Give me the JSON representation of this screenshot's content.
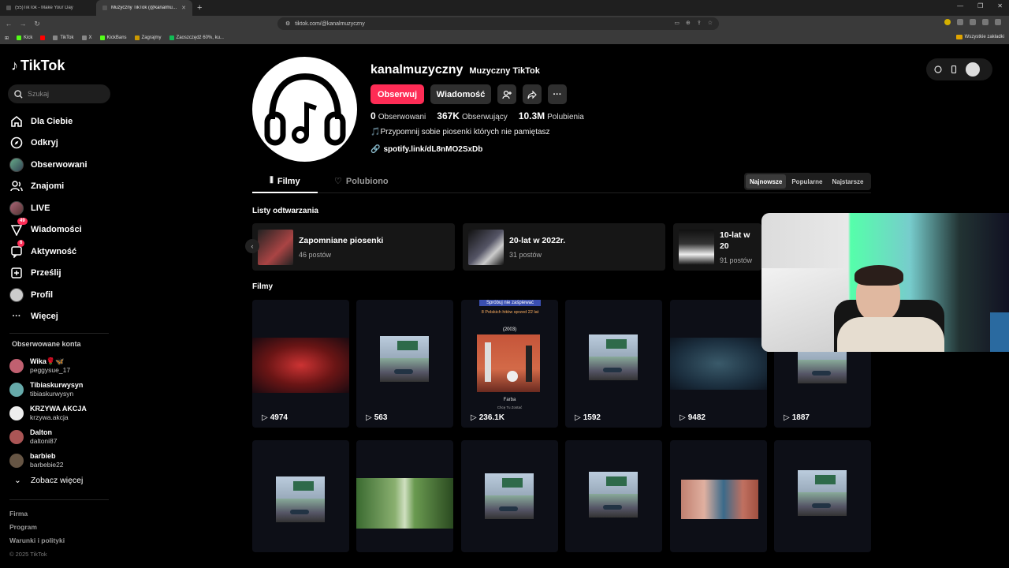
{
  "browser": {
    "tabs": [
      {
        "title": "(55)TikTok - Make Your Day",
        "active": false
      },
      {
        "title": "Muzyczny TikTok (@kanalmuzyczny)",
        "active": true
      }
    ],
    "url": "tiktok.com/@kanalmuzyczny",
    "bookmarks": [
      "Kick",
      "",
      "TikTok",
      "X",
      "KickBans",
      "Zagrajmy",
      "Zaoszczędź 60%, ku..."
    ],
    "all_bookmarks": "Wszystkie zakładki"
  },
  "sidebar": {
    "logo": "TikTok",
    "search_placeholder": "Szukaj",
    "nav": [
      {
        "label": "Dla Ciebie",
        "icon": "home-icon"
      },
      {
        "label": "Odkryj",
        "icon": "compass-icon"
      },
      {
        "label": "Obserwowani",
        "icon": "avatar"
      },
      {
        "label": "Znajomi",
        "icon": "friends-icon"
      },
      {
        "label": "LIVE",
        "icon": "avatar"
      },
      {
        "label": "Wiadomości",
        "icon": "messages-icon",
        "badge": "49"
      },
      {
        "label": "Aktywność",
        "icon": "activity-icon",
        "badge": "6"
      },
      {
        "label": "Prześlij",
        "icon": "upload-icon"
      },
      {
        "label": "Profil",
        "icon": "avatar"
      },
      {
        "label": "Więcej",
        "icon": "more-icon"
      }
    ],
    "followed_title": "Obserwowane konta",
    "followed": [
      {
        "name": "Wika🌹🦋",
        "handle": "peggysue_17",
        "color": "#c06070"
      },
      {
        "name": "Tibiaskurwysyn",
        "handle": "tibiaskurwysyn",
        "color": "#6aa"
      },
      {
        "name": "KRZYWA AKCJA",
        "handle": "krzywa.akcja",
        "color": "#eee"
      },
      {
        "name": "Dalton",
        "handle": "daltoni87",
        "color": "#a55"
      },
      {
        "name": "barbieb",
        "handle": "barbebie22",
        "color": "#654"
      }
    ],
    "see_more": "Zobacz więcej",
    "footer": [
      "Firma",
      "Program",
      "Warunki i polityki"
    ],
    "copyright": "© 2025 TikTok"
  },
  "profile": {
    "username": "kanalmuzyczny",
    "nickname": "Muzyczny TikTok",
    "follow_label": "Obserwuj",
    "message_label": "Wiadomość",
    "following_count": "0",
    "following_label": "Obserwowani",
    "followers_count": "367K",
    "followers_label": "Obserwujący",
    "likes_count": "10.3M",
    "likes_label": "Polubienia",
    "bio": "🎵Przypomnij sobie piosenki których nie pamiętasz",
    "link": "spotify.link/dL8nMO2SxDb"
  },
  "tabs": {
    "videos": "Filmy",
    "liked": "Polubiono"
  },
  "sort": [
    "Najnowsze",
    "Popularne",
    "Najstarsze"
  ],
  "playlists_title": "Listy odtwarzania",
  "playlists": [
    {
      "title": "Zapomniane piosenki",
      "count": "46 postów",
      "color": "#a44"
    },
    {
      "title": "20-lat w 2022r.",
      "count": "31 postów",
      "color": "#556"
    },
    {
      "title": "10-lat w 20",
      "count": "91 postów",
      "color": "#333"
    }
  ],
  "videos_title": "Filmy",
  "videos": [
    {
      "views": "4974",
      "kind": "red"
    },
    {
      "views": "563",
      "kind": "sign"
    },
    {
      "views": "236.1K",
      "kind": "band",
      "overlay_top": "Spróbuj nie zaśpiewać",
      "overlay_mid": "8 Polskich hitów sprzed 22 lat",
      "overlay_year": "(2003)",
      "overlay_artist": "Farba",
      "overlay_song": "Chcę Tu Zostać"
    },
    {
      "views": "1592",
      "kind": "sign"
    },
    {
      "views": "9482",
      "kind": "dark"
    },
    {
      "views": "1887",
      "kind": "sign"
    },
    {
      "views": "",
      "kind": "sign"
    },
    {
      "views": "",
      "kind": "forest"
    },
    {
      "views": "",
      "kind": "sign"
    },
    {
      "views": "",
      "kind": "sign"
    },
    {
      "views": "",
      "kind": "faces"
    },
    {
      "views": "",
      "kind": "sign"
    }
  ]
}
